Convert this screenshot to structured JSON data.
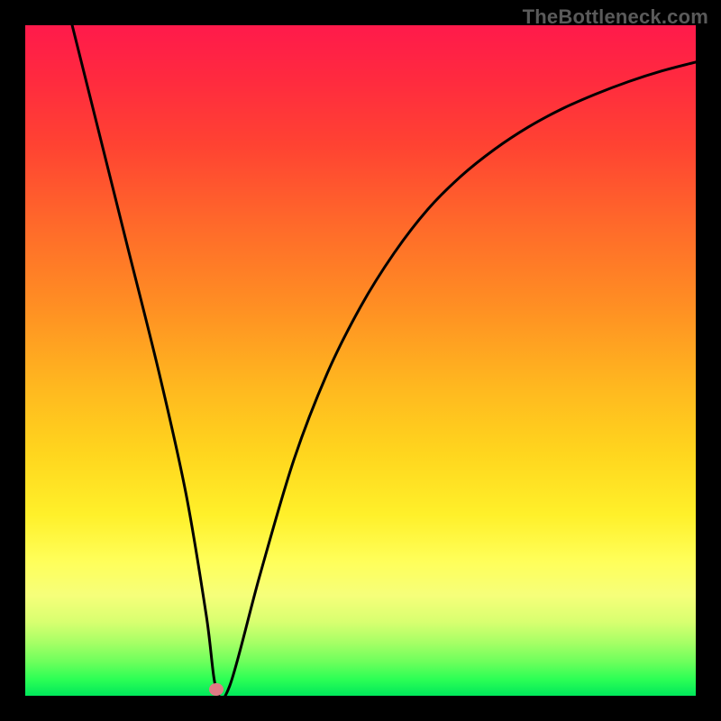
{
  "watermark": "TheBottleneck.com",
  "chart_data": {
    "type": "line",
    "title": "",
    "xlabel": "",
    "ylabel": "",
    "xlim": [
      0,
      100
    ],
    "ylim": [
      0,
      100
    ],
    "series": [
      {
        "name": "curve",
        "x": [
          7,
          10,
          15,
          20,
          24,
          27,
          28.5,
          30.5,
          35,
          40,
          45,
          50,
          55,
          60,
          65,
          70,
          75,
          80,
          85,
          90,
          95,
          100
        ],
        "values": [
          100,
          88,
          68,
          48,
          30,
          12,
          1,
          1.5,
          18,
          35,
          48,
          58,
          66,
          72.5,
          77.5,
          81.5,
          84.8,
          87.5,
          89.7,
          91.6,
          93.2,
          94.5
        ]
      }
    ],
    "marker": {
      "x": 28.5,
      "y": 1
    }
  },
  "colors": {
    "curve": "#000000",
    "marker": "#e07a85",
    "gradient_top": "#ff1a4b",
    "gradient_bottom": "#00e85b"
  }
}
